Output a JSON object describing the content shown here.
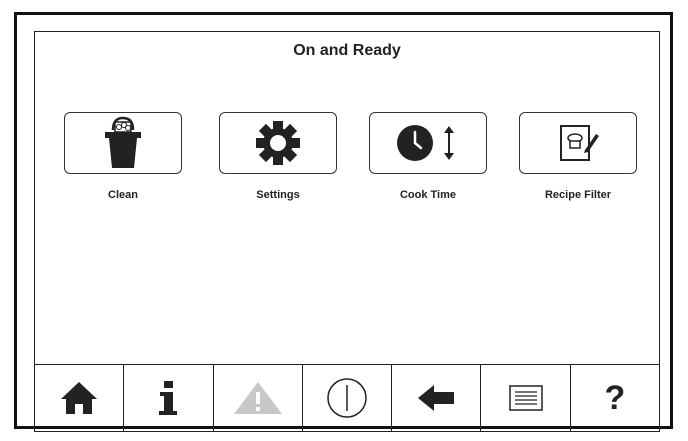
{
  "header": {
    "title": "On and Ready"
  },
  "tiles": [
    {
      "label": "Clean",
      "icon": "clean-bucket-icon"
    },
    {
      "label": "Settings",
      "icon": "gear-icon"
    },
    {
      "label": "Cook Time",
      "icon": "clock-adjust-icon"
    },
    {
      "label": "Recipe Filter",
      "icon": "recipe-filter-icon"
    }
  ],
  "navbar": {
    "items": [
      {
        "icon": "home-icon"
      },
      {
        "icon": "info-icon"
      },
      {
        "icon": "warning-icon",
        "state": "disabled"
      },
      {
        "icon": "power-icon"
      },
      {
        "icon": "back-arrow-icon"
      },
      {
        "icon": "menu-list-icon"
      },
      {
        "icon": "help-icon",
        "glyph": "?"
      }
    ]
  },
  "colors": {
    "icon": "#222222",
    "disabled": "#c8c8c8",
    "border": "#111111"
  }
}
